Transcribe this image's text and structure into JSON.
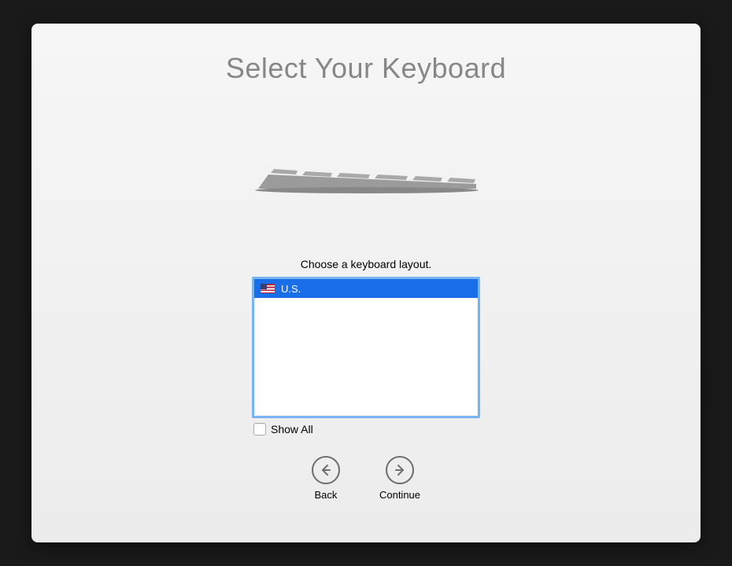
{
  "title": "Select Your Keyboard",
  "instruction": "Choose a keyboard layout.",
  "layouts": {
    "selected_index": 0,
    "items": [
      {
        "name": "U.S.",
        "flag": "us"
      }
    ]
  },
  "show_all": {
    "label": "Show All",
    "checked": false
  },
  "nav": {
    "back_label": "Back",
    "continue_label": "Continue"
  }
}
